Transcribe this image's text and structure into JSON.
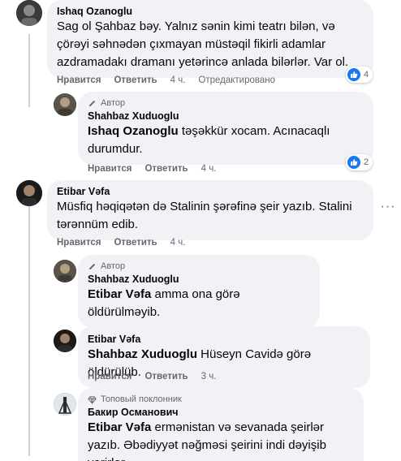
{
  "labels": {
    "like": "Нравится",
    "reply": "Ответить",
    "edited": "Отредактировано",
    "author_badge": "Автор",
    "top_fan_badge": "Топовый поклонник"
  },
  "comments": [
    {
      "author": "Ishaq Ozanoglu",
      "text": "Sag ol Şahbaz bəy. Yalnız sənin kimi teatrı bilən, və çörəyi səhnədən çıxmayan müstəqil fikirli adamlar azdramadakı dramanı yetərincə anlada bilərlər. Var ol.",
      "time": "4 ч.",
      "likes": "4"
    },
    {
      "author": "Shahbaz Xuduoglu",
      "mention": "Ishaq Ozanoglu",
      "text": " təşəkkür xocam. Acınacaqlı durumdur.",
      "time": "4 ч.",
      "likes": "2"
    },
    {
      "author": "Etibar Vəfa",
      "text": "Müsfiq həqiqətən də Stalinin şərəfinə şeir yazıb. Stalini tərənnüm edib.",
      "time": "4 ч."
    },
    {
      "author": "Shahbaz Xuduoglu",
      "mention": "Etibar Vəfa",
      "text": " amma ona görə öldürülməyib."
    },
    {
      "author": "Etibar Vəfa",
      "mention": "Shahbaz Xuduoglu",
      "text": " Hüseyn Cavidə görə öldürülüb.",
      "time": "3 ч."
    },
    {
      "author": "Бакир Османович",
      "mention": "Etibar Vəfa",
      "text": " ermənistan və sevanada şeirlər yazıb. Əbədiyyət nəğməsi şeirini indi dəyişib verirlər"
    }
  ],
  "colors": {
    "accent": "#1877f2",
    "bubble": "#f0f2f5",
    "muted": "#65676b"
  }
}
